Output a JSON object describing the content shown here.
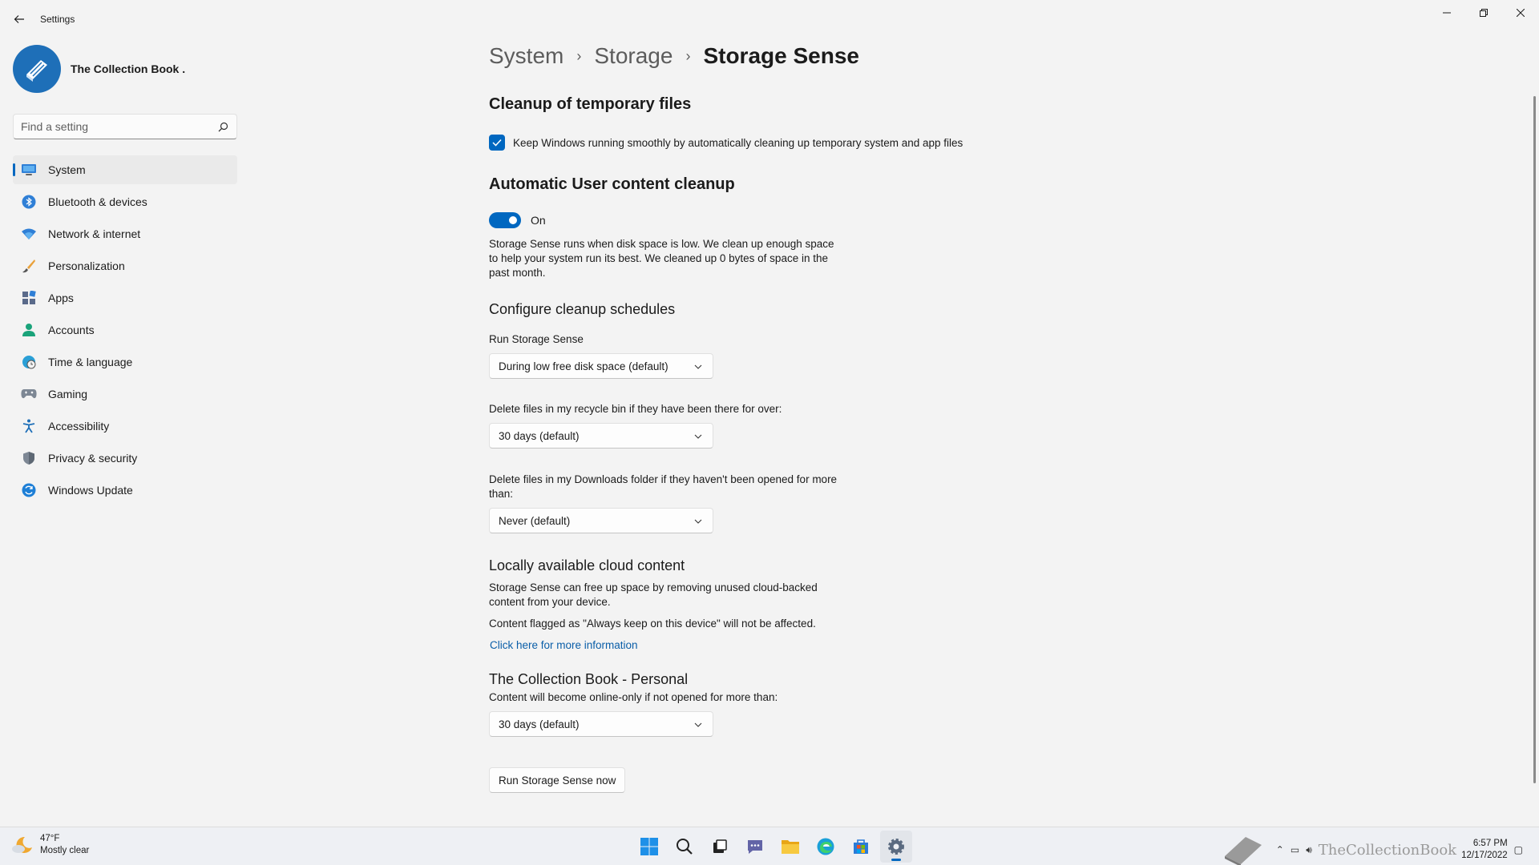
{
  "window": {
    "app_title": "Settings"
  },
  "profile": {
    "name": "The Collection Book ."
  },
  "search": {
    "placeholder": "Find a setting"
  },
  "nav": {
    "items": [
      {
        "label": "System",
        "icon": "monitor-icon"
      },
      {
        "label": "Bluetooth & devices",
        "icon": "bluetooth-icon"
      },
      {
        "label": "Network & internet",
        "icon": "wifi-icon"
      },
      {
        "label": "Personalization",
        "icon": "brush-icon"
      },
      {
        "label": "Apps",
        "icon": "apps-icon"
      },
      {
        "label": "Accounts",
        "icon": "person-icon"
      },
      {
        "label": "Time & language",
        "icon": "globe-clock-icon"
      },
      {
        "label": "Gaming",
        "icon": "gamepad-icon"
      },
      {
        "label": "Accessibility",
        "icon": "accessibility-icon"
      },
      {
        "label": "Privacy & security",
        "icon": "shield-icon"
      },
      {
        "label": "Windows Update",
        "icon": "update-icon"
      }
    ],
    "active": "System"
  },
  "breadcrumb": {
    "items": [
      "System",
      "Storage"
    ],
    "current": "Storage Sense"
  },
  "temp_files": {
    "title": "Cleanup of temporary files",
    "checkbox_label": "Keep Windows running smoothly by automatically cleaning up temporary system and app files",
    "checked": true
  },
  "user_content": {
    "title": "Automatic User content cleanup",
    "toggle_label": "On",
    "toggle_on": true,
    "description": "Storage Sense runs when disk space is low. We clean up enough space to help your system run its best. We cleaned up 0 bytes of space in the past month."
  },
  "schedules": {
    "title": "Configure cleanup schedules",
    "run_label": "Run Storage Sense",
    "run_value": "During low free disk space (default)",
    "recycle_label": "Delete files in my recycle bin if they have been there for over:",
    "recycle_value": "30 days (default)",
    "downloads_label": "Delete files in my Downloads folder if they haven't been opened for more than:",
    "downloads_value": "Never (default)"
  },
  "cloud": {
    "title": "Locally available cloud content",
    "description": "Storage Sense can free up space by removing unused cloud-backed content from your device.",
    "note": "Content flagged as \"Always keep on this device\" will not be affected.",
    "link": "Click here for more information"
  },
  "onedrive": {
    "title": "The Collection Book - Personal",
    "label": "Content will become online-only if not opened for more than:",
    "value": "30 days (default)"
  },
  "actions": {
    "run_now": "Run Storage Sense now"
  },
  "taskbar": {
    "weather_temp": "47°F",
    "weather_desc": "Mostly clear",
    "watermark": "TheCollectionBook",
    "time": "6:57 PM",
    "date": "12/17/2022"
  },
  "colors": {
    "accent": "#0067c0",
    "background": "#f3f3f3"
  }
}
